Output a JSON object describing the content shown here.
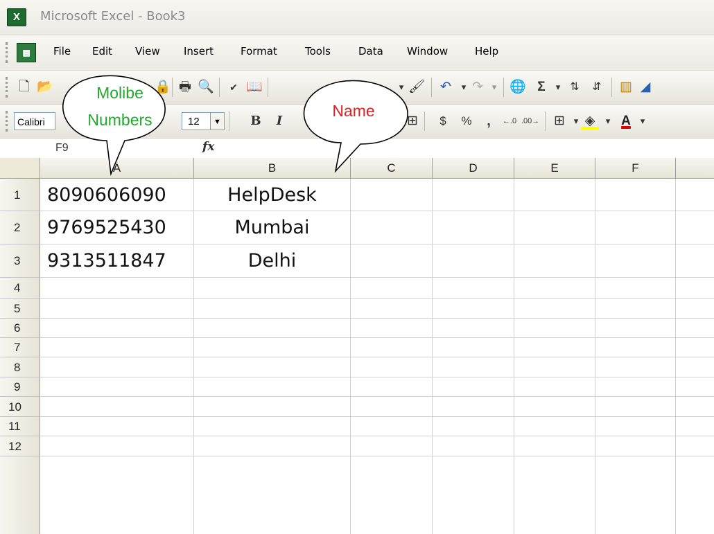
{
  "window": {
    "title": "Microsoft Excel - Book3",
    "app_icon_glyph": "X"
  },
  "menu": {
    "items": [
      "File",
      "Edit",
      "View",
      "Insert",
      "Format",
      "Tools",
      "Data",
      "Window",
      "Help"
    ]
  },
  "format_toolbar": {
    "font_name": "Calibri",
    "font_size": "12",
    "bold_label": "B",
    "italic_label": "I",
    "currency_label": "$",
    "percent_label": "%",
    "comma_label": ","
  },
  "formula_bar": {
    "name_box": "F9",
    "fx_label": "fx"
  },
  "sheet": {
    "columns": [
      "A",
      "B",
      "C",
      "D",
      "E",
      "F"
    ],
    "rows": [
      "1",
      "2",
      "3",
      "4",
      "5",
      "6",
      "7",
      "8",
      "9",
      "10",
      "11",
      "12"
    ],
    "cells": [
      {
        "a": "8090606090",
        "b": "HelpDesk"
      },
      {
        "a": "9769525430",
        "b": "Mumbai"
      },
      {
        "a": "9313511847",
        "b": "Delhi"
      }
    ]
  },
  "callouts": {
    "mobile": {
      "line1": "Molibe",
      "line2": "Numbers",
      "color": "#22a82b"
    },
    "name": {
      "text": "Name",
      "color": "#e02020"
    }
  }
}
